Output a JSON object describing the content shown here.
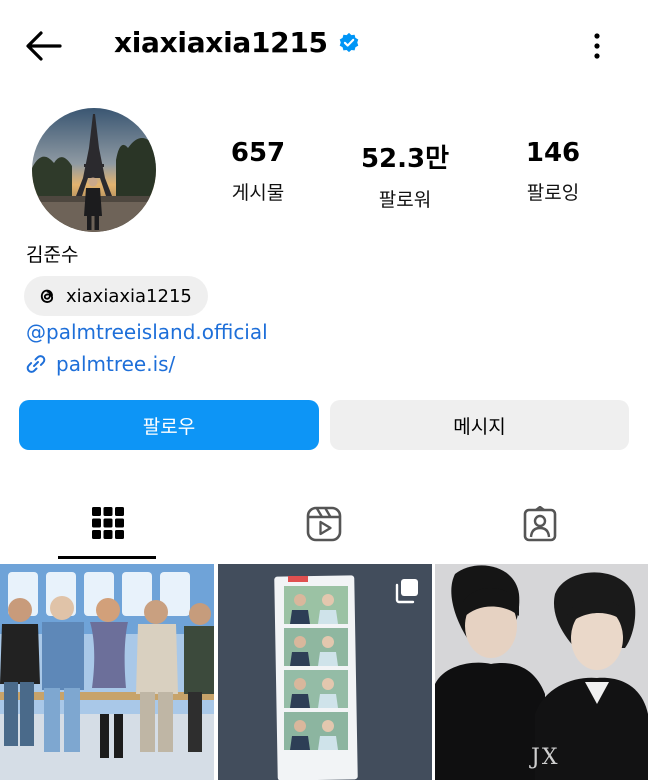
{
  "header": {
    "username": "xiaxiaxia1215",
    "verified_icon": "verified-badge-icon",
    "back_icon": "arrow-left-icon",
    "more_icon": "more-vertical-icon",
    "accent_color": "#0095f6"
  },
  "profile": {
    "full_name": "김준수",
    "stats": {
      "posts": {
        "value": "657",
        "label": "게시물"
      },
      "followers": {
        "value": "52.3만",
        "label": "팔로워"
      },
      "following": {
        "value": "146",
        "label": "팔로잉"
      }
    },
    "threads_handle": "xiaxiaxia1215",
    "mention": "@palmtreeisland.official",
    "link": "palmtree.is/",
    "link_color": "#1e6fd9"
  },
  "actions": {
    "follow_label": "팔로우",
    "message_label": "메시지",
    "follow_color": "#0d95f6"
  },
  "tabs": [
    {
      "name": "posts",
      "icon": "grid-icon",
      "active": true
    },
    {
      "name": "reels",
      "icon": "reels-icon",
      "active": false
    },
    {
      "name": "tagged",
      "icon": "tagged-person-icon",
      "active": false
    }
  ],
  "grid_posts": [
    {
      "icon": "photo",
      "multi": false
    },
    {
      "icon": "photo",
      "multi": true
    },
    {
      "icon": "photo",
      "multi": false,
      "overlay_text": "JX"
    }
  ]
}
